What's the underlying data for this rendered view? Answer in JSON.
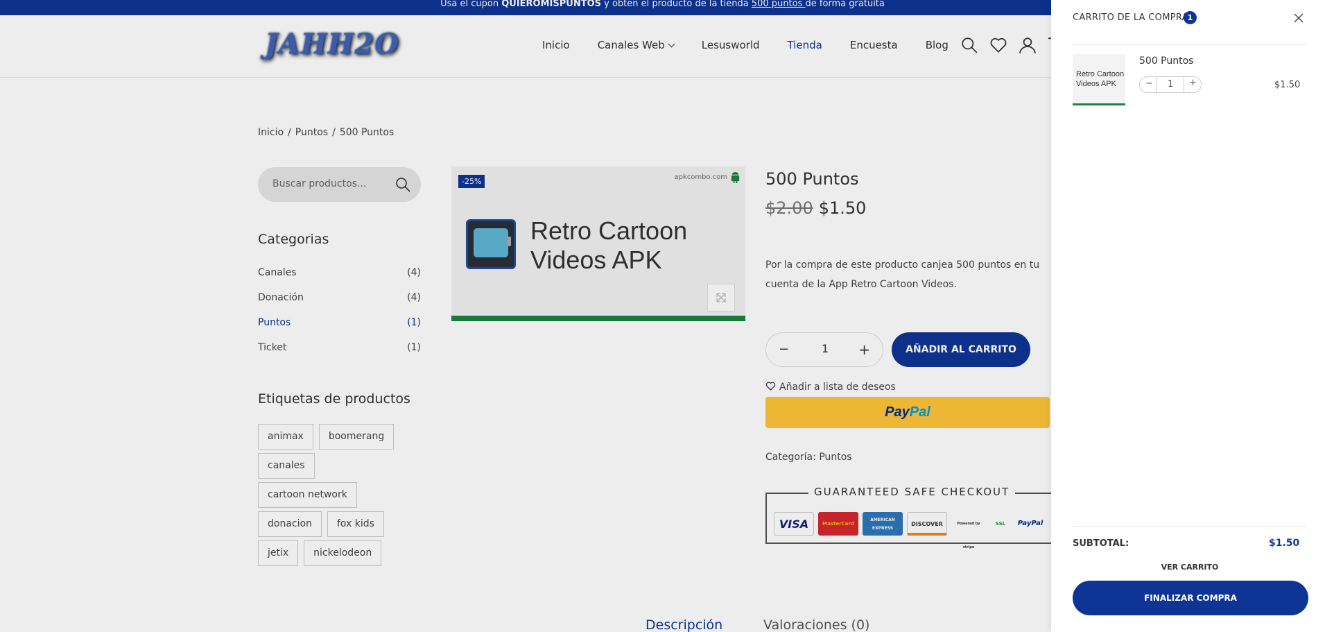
{
  "announcement": {
    "prefix": "Usa el cupon ",
    "coupon": "QUIEROMISPUNTOS",
    "middle": " y obten el producto de la tienda ",
    "link": " 500 puntos ",
    "suffix": " de forma gratuita"
  },
  "header": {
    "logo": "JAHH2O",
    "nav": [
      {
        "label": "Inicio"
      },
      {
        "label": "Canales Web"
      },
      {
        "label": "Lesusworld"
      },
      {
        "label": "Tienda"
      },
      {
        "label": "Encuesta"
      },
      {
        "label": "Blog"
      }
    ],
    "icons": [
      "search-icon",
      "heart-icon",
      "user-icon",
      "cart-icon"
    ]
  },
  "breadcrumb": [
    "Inicio",
    "Puntos",
    "500 Puntos"
  ],
  "sidebar": {
    "search_placeholder": "Buscar productos...",
    "categories_title": "Categorias",
    "categories": [
      {
        "name": "Canales",
        "count": "(4)"
      },
      {
        "name": "Donación",
        "count": "(4)"
      },
      {
        "name": "Puntos",
        "count": "(1)"
      },
      {
        "name": "Ticket",
        "count": "(1)"
      }
    ],
    "tags_title": "Etiquetas de productos",
    "tags": [
      "animax",
      "boomerang",
      "canales",
      "cartoon network",
      "donacion",
      "fox kids",
      "jetix",
      "nickelodeon"
    ]
  },
  "product": {
    "badge": "-25%",
    "image_source": "apkcombo.com",
    "image_title_line1": "Retro Cartoon",
    "image_title_line2": "Videos APK",
    "title": "500 Puntos",
    "old_price": "$2.00",
    "price": "$1.50",
    "description": "Por la compra de este producto canjea 500 puntos en tu cuenta de la App Retro Cartoon Videos.",
    "qty_minus": "−",
    "qty_value": "1",
    "qty_plus": "+",
    "add_to_cart": "AÑADIR AL CARRITO",
    "wishlist": "Añadir a lista de deseos",
    "paypal_a": "Pay",
    "paypal_b": "Pal",
    "category_label": "Categoría: ",
    "category_value": "Puntos",
    "checkout_title": "GUARANTEED SAFE CHECKOUT",
    "payment_logos": [
      "VISA",
      "MasterCard",
      "AMERICAN EXPRESS",
      "DISCOVER",
      "Powered by stripe",
      "SSL",
      "PayPal"
    ]
  },
  "tabs": [
    {
      "label": "Descripción"
    },
    {
      "label": "Valoraciones (0)"
    }
  ],
  "cart": {
    "title": "CARRITO DE LA COMPRA",
    "count": "1",
    "item_thumb_line1": "Retro Cartoon",
    "item_thumb_line2": "Videos APK",
    "item_name": "500 Puntos",
    "item_minus": "−",
    "item_qty": "1",
    "item_plus": "+",
    "item_price": "$1.50",
    "subtotal_label": "SUBTOTAL:",
    "subtotal_value": "$1.50",
    "view_cart": "VER CARRITO",
    "checkout": "FINALIZAR COMPRA"
  },
  "colors": {
    "primary": "#0e3596",
    "green_bar": "#19843f",
    "paypal_yellow": "#ffc439"
  }
}
